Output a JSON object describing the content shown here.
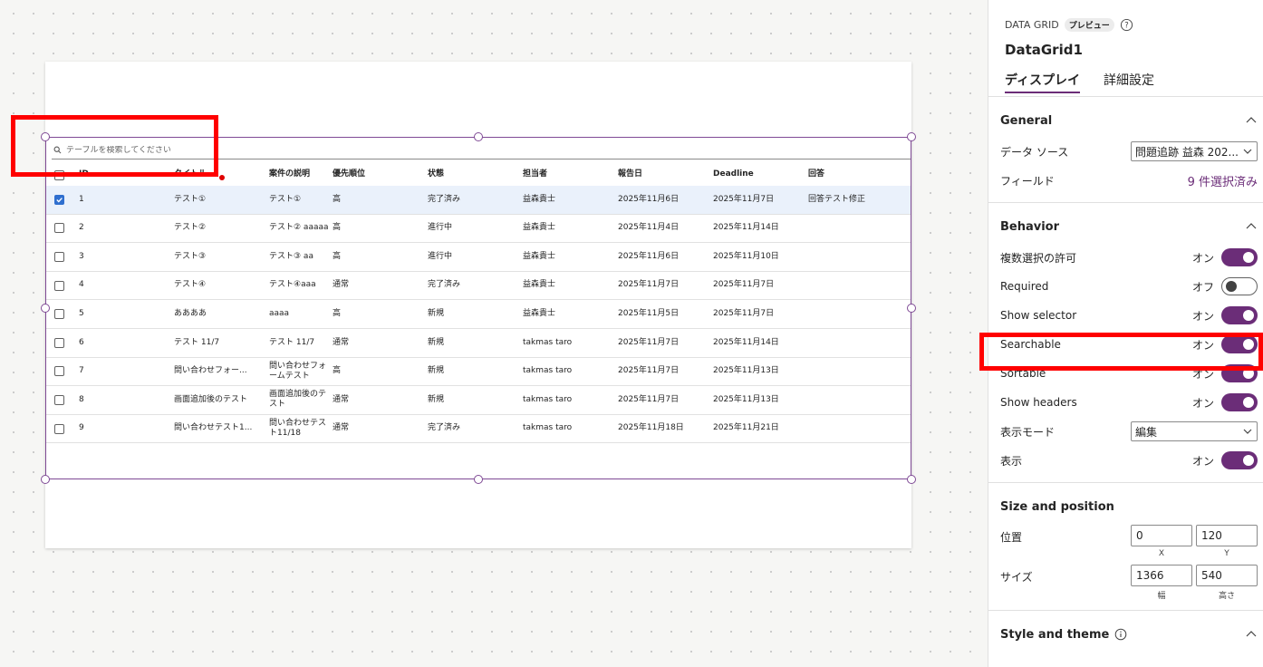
{
  "canvas": {
    "search_placeholder": "テーブルを検索してください",
    "columns": [
      {
        "label": "ID",
        "col": 1
      },
      {
        "label": "タイトル",
        "col": 2
      },
      {
        "label": "案件の説明",
        "col": 3
      },
      {
        "label": "優先順位",
        "col": 4
      },
      {
        "label": "状態",
        "col": 5
      },
      {
        "label": "担当者",
        "col": 6
      },
      {
        "label": "報告日",
        "col": 7
      },
      {
        "label": "Deadline",
        "col": 8
      },
      {
        "label": "回答",
        "col": 9
      }
    ],
    "rows": [
      {
        "checked": true,
        "cells": [
          "1",
          "テスト①",
          "テスト①",
          "高",
          "完了済み",
          "益森貴士",
          "2025年11月6日",
          "2025年11月7日",
          "回答テスト修正"
        ]
      },
      {
        "checked": false,
        "cells": [
          "2",
          "テスト②",
          "テスト② aaaaa",
          "高",
          "進行中",
          "益森貴士",
          "2025年11月4日",
          "2025年11月14日",
          ""
        ]
      },
      {
        "checked": false,
        "cells": [
          "3",
          "テスト③",
          "テスト③ aa",
          "高",
          "進行中",
          "益森貴士",
          "2025年11月6日",
          "2025年11月10日",
          ""
        ]
      },
      {
        "checked": false,
        "cells": [
          "4",
          "テスト④",
          "テスト④aaa",
          "通常",
          "完了済み",
          "益森貴士",
          "2025年11月7日",
          "2025年11月7日",
          ""
        ]
      },
      {
        "checked": false,
        "cells": [
          "5",
          "ああああ",
          "aaaa",
          "高",
          "新規",
          "益森貴士",
          "2025年11月5日",
          "2025年11月7日",
          ""
        ]
      },
      {
        "checked": false,
        "cells": [
          "6",
          "テスト 11/7",
          "テスト 11/7",
          "通常",
          "新規",
          "takmas taro",
          "2025年11月7日",
          "2025年11月14日",
          ""
        ]
      },
      {
        "checked": false,
        "cells": [
          "7",
          "問い合わせフォー...",
          "問い合わせフォームテスト",
          "高",
          "新規",
          "takmas taro",
          "2025年11月7日",
          "2025年11月13日",
          ""
        ]
      },
      {
        "checked": false,
        "cells": [
          "8",
          "画面追加後のテスト",
          "画面追加後のテスト",
          "通常",
          "新規",
          "takmas taro",
          "2025年11月7日",
          "2025年11月13日",
          ""
        ]
      },
      {
        "checked": false,
        "cells": [
          "9",
          "問い合わせテスト1...",
          "問い合わせテスト11/18",
          "通常",
          "完了済み",
          "takmas taro",
          "2025年11月18日",
          "2025年11月21日",
          ""
        ]
      }
    ]
  },
  "panel": {
    "control_type": "DATA GRID",
    "preview_badge": "プレビュー",
    "control_name": "DataGrid1",
    "tabs": [
      {
        "label": "ディスプレイ",
        "active": true
      },
      {
        "label": "詳細設定",
        "active": false
      }
    ],
    "general": {
      "title": "General",
      "data_source_label": "データ ソース",
      "data_source_value": "問題追跡 益森 202...",
      "fields_label": "フィールド",
      "fields_value": "9 件選択済み"
    },
    "behavior": {
      "title": "Behavior",
      "items": [
        {
          "label": "複数選択の許可",
          "state": "オン",
          "on": true
        },
        {
          "label": "Required",
          "state": "オフ",
          "on": false
        },
        {
          "label": "Show selector",
          "state": "オン",
          "on": true
        },
        {
          "label": "Searchable",
          "state": "オン",
          "on": true
        },
        {
          "label": "Sortable",
          "state": "オン",
          "on": true
        },
        {
          "label": "Show headers",
          "state": "オン",
          "on": true
        }
      ],
      "display_mode_label": "表示モード",
      "display_mode_value": "編集",
      "visible_label": "表示",
      "visible_state": "オン"
    },
    "size_position": {
      "title": "Size and position",
      "position_label": "位置",
      "x_value": "0",
      "y_value": "120",
      "x_caption": "X",
      "y_caption": "Y",
      "size_label": "サイズ",
      "width_value": "1366",
      "height_value": "540",
      "width_caption": "幅",
      "height_caption": "高さ"
    },
    "style_theme": {
      "title": "Style and theme"
    }
  },
  "colors": {
    "accent": "#6b2d78",
    "highlight": "#ff0000",
    "selection": "#2f6fcf"
  }
}
